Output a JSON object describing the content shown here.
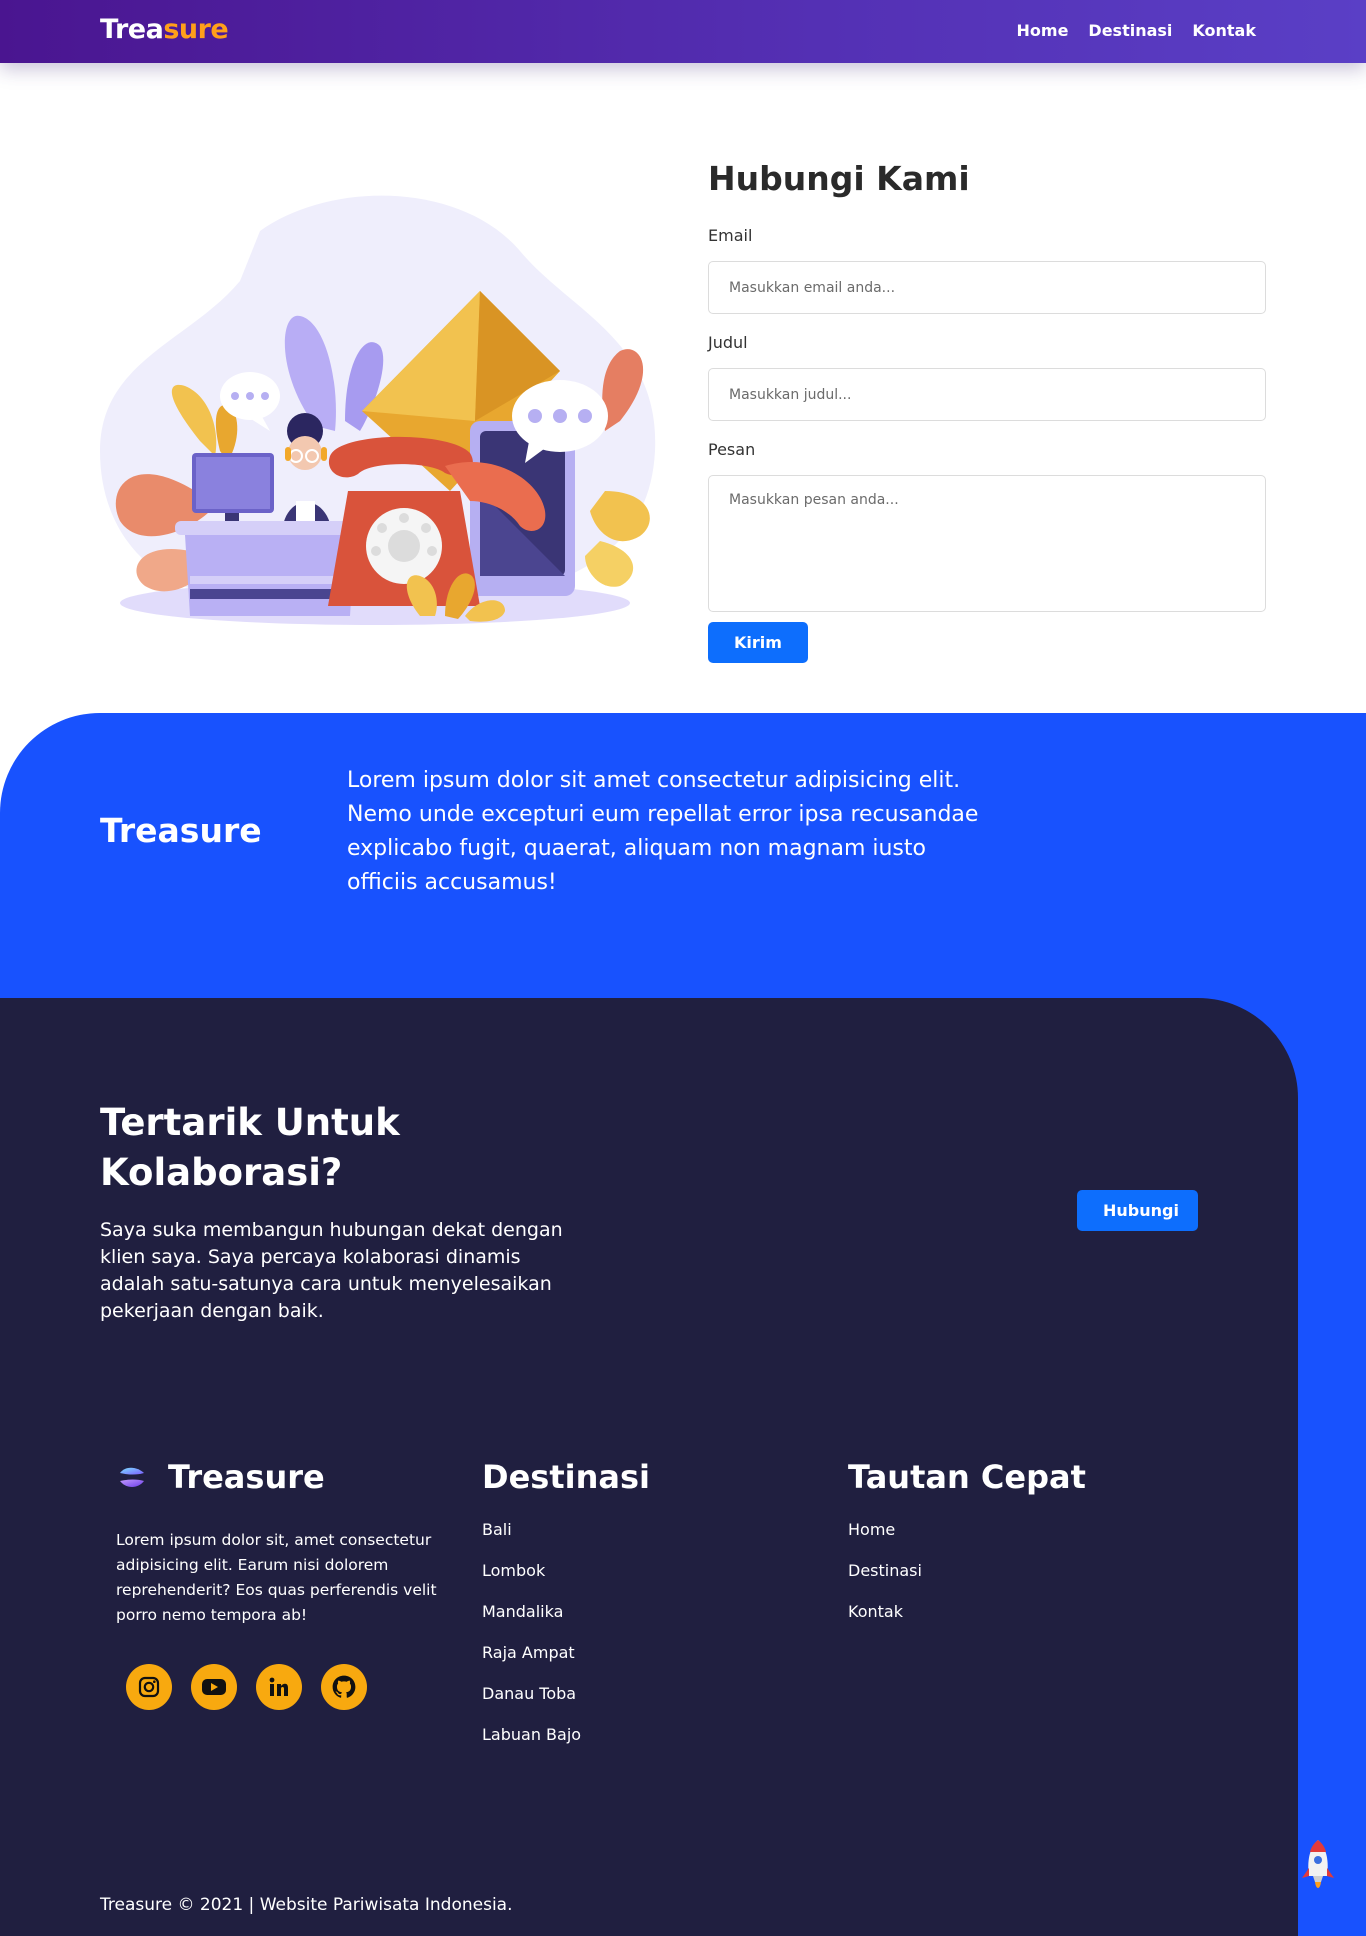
{
  "nav": {
    "brand_part1": "Trea",
    "brand_part2": "sure",
    "links": [
      "Home",
      "Destinasi",
      "Kontak"
    ]
  },
  "contact": {
    "title": "Hubungi Kami",
    "email_label": "Email",
    "email_placeholder": "Masukkan email anda...",
    "title_label": "Judul",
    "title_placeholder": "Masukkan judul...",
    "message_label": "Pesan",
    "message_placeholder": "Masukkan pesan anda...",
    "submit_label": "Kirim"
  },
  "band": {
    "brand": "Treasure",
    "text": "Lorem ipsum dolor sit amet consectetur adipisicing elit. Nemo unde excepturi eum repellat error ipsa recusandae explicabo fugit, quaerat, aliquam non magnam iusto officiis accusamus!"
  },
  "collab": {
    "title_line1": "Tertarik Untuk",
    "title_line2": "Kolaborasi?",
    "description": "Saya suka membangun hubungan dekat dengan klien saya. Saya percaya kolaborasi dinamis adalah satu-satunya cara untuk menyelesaikan pekerjaan dengan baik.",
    "button_label": "Hubungi"
  },
  "footer": {
    "brand": "Treasure",
    "about": "Lorem ipsum dolor sit, amet consectetur adipisicing elit. Earum nisi dolorem reprehenderit? Eos quas perferendis velit porro nemo tempora ab!",
    "socials": [
      "instagram-icon",
      "youtube-icon",
      "linkedin-icon",
      "github-icon"
    ],
    "destinations_title": "Destinasi",
    "destinations": [
      "Bali",
      "Lombok",
      "Mandalika",
      "Raja Ampat",
      "Danau Toba",
      "Labuan Bajo"
    ],
    "quicklinks_title": "Tautan Cepat",
    "quicklinks": [
      "Home",
      "Destinasi",
      "Kontak"
    ],
    "copyright": "Treasure © 2021 | Website Pariwisata Indonesia."
  },
  "colors": {
    "nav_gradient_start": "#4a1590",
    "nav_gradient_end": "#5a3fc6",
    "brand_accent": "#ff9f1a",
    "primary_button": "#0d6efd",
    "band_blue": "#1852fe",
    "footer_dark": "#201f40",
    "social_orange": "#f8a90f"
  }
}
